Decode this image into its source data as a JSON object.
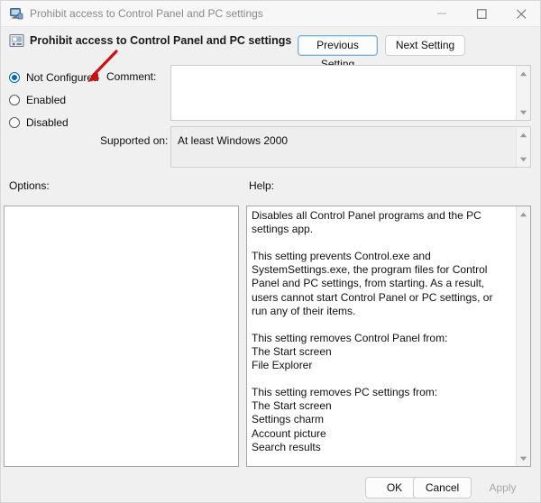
{
  "window": {
    "title": "Prohibit access to Control Panel and PC settings",
    "title_icon": "computer-monitor-icon",
    "controls": {
      "minimize": "minimize-icon",
      "maximize": "maximize-icon",
      "close": "close-icon"
    }
  },
  "header": {
    "icon": "policy-setting-icon",
    "title": "Prohibit access to Control Panel and PC settings"
  },
  "nav": {
    "previous_label": "Previous Setting",
    "next_label": "Next Setting"
  },
  "state_options": [
    {
      "label": "Not Configured",
      "selected": true
    },
    {
      "label": "Enabled",
      "selected": false
    },
    {
      "label": "Disabled",
      "selected": false
    }
  ],
  "comment": {
    "label": "Comment:",
    "value": "",
    "placeholder": ""
  },
  "supported_on": {
    "label": "Supported on:",
    "value": "At least Windows 2000"
  },
  "panels": {
    "options_label": "Options:",
    "options_content": "",
    "help_label": "Help:",
    "help_text": "Disables all Control Panel programs and the PC settings app.\n\nThis setting prevents Control.exe and SystemSettings.exe, the program files for Control Panel and PC settings, from starting. As a result, users cannot start Control Panel or PC settings, or run any of their items.\n\nThis setting removes Control Panel from:\nThe Start screen\nFile Explorer\n\nThis setting removes PC settings from:\nThe Start screen\nSettings charm\nAccount picture\nSearch results\n\nIf users try to select a Control Panel item from the Properties item on a context menu, a message appears explaining that a setting prevents the action."
  },
  "footer": {
    "ok_label": "OK",
    "cancel_label": "Cancel",
    "apply_label": "Apply",
    "apply_disabled": true
  },
  "annotation": {
    "type": "arrow",
    "color": "#cc1111",
    "points_to": "Not Configured"
  },
  "colors": {
    "accent": "#0067c0",
    "window_background": "#f0f0f0",
    "panel_background": "#ffffff",
    "annotation_red": "#cc1111",
    "disabled_text": "#a8a8a8"
  }
}
